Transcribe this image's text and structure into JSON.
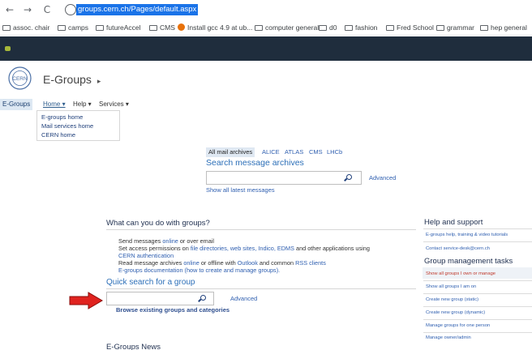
{
  "browser": {
    "url": "groups.cern.ch/Pages/default.aspx",
    "back": "←",
    "forward": "→",
    "reload": "C",
    "bookmarks": [
      {
        "label": "assoc. chair",
        "icon": "folder-icon"
      },
      {
        "label": "camps",
        "icon": "folder-icon"
      },
      {
        "label": "futureAccel",
        "icon": "folder-icon"
      },
      {
        "label": "CMS",
        "icon": "folder-icon"
      },
      {
        "label": "Install gcc 4.9 at ub...",
        "icon": "site-favicon"
      },
      {
        "label": "computer general",
        "icon": "folder-icon"
      },
      {
        "label": "d0",
        "icon": "folder-icon"
      },
      {
        "label": "fashion",
        "icon": "folder-icon"
      },
      {
        "label": "Fred School",
        "icon": "folder-icon"
      },
      {
        "label": "grammar",
        "icon": "folder-icon"
      },
      {
        "label": "hep general",
        "icon": "folder-icon"
      }
    ]
  },
  "site": {
    "title": "E-Groups",
    "title_chevron": "▸",
    "logo_text": "CERN"
  },
  "nav": {
    "egroups": "E-Groups",
    "home": "Home ▾",
    "help": "Help ▾",
    "services": "Services ▾",
    "home_menu": [
      "E-groups home",
      "Mail services home",
      "CERN home"
    ]
  },
  "archives": {
    "tabs": [
      "All mail archives",
      "ALICE",
      "ATLAS",
      "CMS",
      "LHCb"
    ],
    "title": "Search message archives",
    "search_value": "",
    "advanced": "Advanced",
    "show_all": "Show all latest messages"
  },
  "groups": {
    "title": "What can you do with groups?",
    "line1_a": "Send messages ",
    "line1_link": "online",
    "line1_b": " or over email",
    "line2_a": "Set access permissions on ",
    "line2_link": "file directories, web sites, Indico, EDMS",
    "line2_b": " and other applications using ",
    "line2_link2": "CERN authentication",
    "line3_a": "Read message archives ",
    "line3_link": "online",
    "line3_b": " or offline with ",
    "line3_link2": "Outlook",
    "line3_c": " and common ",
    "line3_link3": "RSS clients",
    "line4": "E-groups documentation (how to create and manage groups).",
    "quick_title": "Quick search for a group",
    "quick_value": "",
    "quick_advanced": "Advanced",
    "browse": "Browse existing groups and categories",
    "news_title": "E-Groups News"
  },
  "sidebar": {
    "help_title": "Help and support",
    "help_links": [
      "E-groups help, training & video tutorials",
      "Contact service-desk@cern.ch"
    ],
    "mgmt_title": "Group management tasks",
    "mgmt_links": [
      {
        "label": "Show all groups I own or manage",
        "color": "#c0392b"
      },
      {
        "label": "Show all groups I am on",
        "color": "#2f5fb0"
      },
      {
        "label": "Create new group (static)",
        "color": "#2f5fb0"
      },
      {
        "label": "Create new group (dynamic)",
        "color": "#2f5fb0"
      },
      {
        "label": "Manage groups for one person",
        "color": "#2f5fb0"
      },
      {
        "label": "Manage owner/admin",
        "color": "#2f5fb0"
      }
    ]
  },
  "colors": {
    "header_bar": "#1f2d3d",
    "link": "#2f5fb0",
    "annotation_arrow": "#e0231f"
  }
}
